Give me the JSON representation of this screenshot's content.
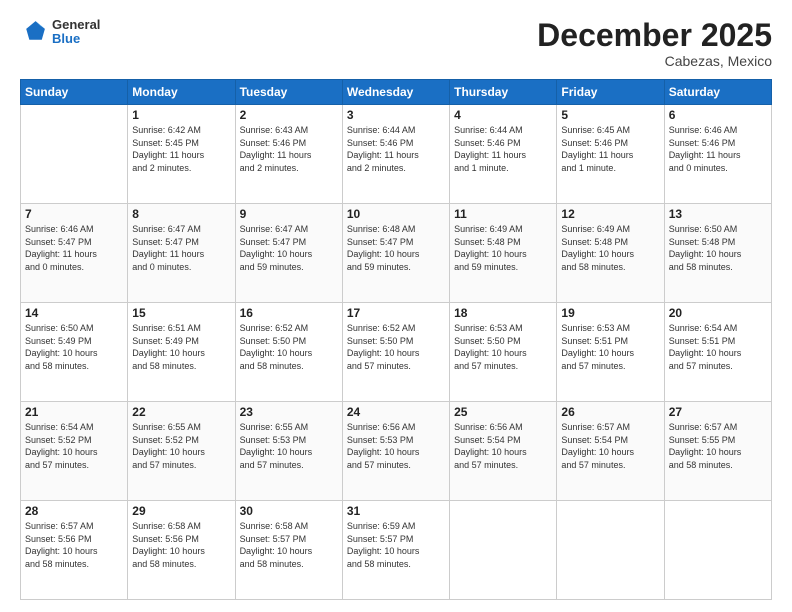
{
  "header": {
    "logo": {
      "general": "General",
      "blue": "Blue"
    },
    "title": "December 2025",
    "subtitle": "Cabezas, Mexico"
  },
  "columns": [
    "Sunday",
    "Monday",
    "Tuesday",
    "Wednesday",
    "Thursday",
    "Friday",
    "Saturday"
  ],
  "weeks": [
    [
      {
        "day": "",
        "info": ""
      },
      {
        "day": "1",
        "info": "Sunrise: 6:42 AM\nSunset: 5:45 PM\nDaylight: 11 hours\nand 2 minutes."
      },
      {
        "day": "2",
        "info": "Sunrise: 6:43 AM\nSunset: 5:46 PM\nDaylight: 11 hours\nand 2 minutes."
      },
      {
        "day": "3",
        "info": "Sunrise: 6:44 AM\nSunset: 5:46 PM\nDaylight: 11 hours\nand 2 minutes."
      },
      {
        "day": "4",
        "info": "Sunrise: 6:44 AM\nSunset: 5:46 PM\nDaylight: 11 hours\nand 1 minute."
      },
      {
        "day": "5",
        "info": "Sunrise: 6:45 AM\nSunset: 5:46 PM\nDaylight: 11 hours\nand 1 minute."
      },
      {
        "day": "6",
        "info": "Sunrise: 6:46 AM\nSunset: 5:46 PM\nDaylight: 11 hours\nand 0 minutes."
      }
    ],
    [
      {
        "day": "7",
        "info": "Sunrise: 6:46 AM\nSunset: 5:47 PM\nDaylight: 11 hours\nand 0 minutes."
      },
      {
        "day": "8",
        "info": "Sunrise: 6:47 AM\nSunset: 5:47 PM\nDaylight: 11 hours\nand 0 minutes."
      },
      {
        "day": "9",
        "info": "Sunrise: 6:47 AM\nSunset: 5:47 PM\nDaylight: 10 hours\nand 59 minutes."
      },
      {
        "day": "10",
        "info": "Sunrise: 6:48 AM\nSunset: 5:47 PM\nDaylight: 10 hours\nand 59 minutes."
      },
      {
        "day": "11",
        "info": "Sunrise: 6:49 AM\nSunset: 5:48 PM\nDaylight: 10 hours\nand 59 minutes."
      },
      {
        "day": "12",
        "info": "Sunrise: 6:49 AM\nSunset: 5:48 PM\nDaylight: 10 hours\nand 58 minutes."
      },
      {
        "day": "13",
        "info": "Sunrise: 6:50 AM\nSunset: 5:48 PM\nDaylight: 10 hours\nand 58 minutes."
      }
    ],
    [
      {
        "day": "14",
        "info": "Sunrise: 6:50 AM\nSunset: 5:49 PM\nDaylight: 10 hours\nand 58 minutes."
      },
      {
        "day": "15",
        "info": "Sunrise: 6:51 AM\nSunset: 5:49 PM\nDaylight: 10 hours\nand 58 minutes."
      },
      {
        "day": "16",
        "info": "Sunrise: 6:52 AM\nSunset: 5:50 PM\nDaylight: 10 hours\nand 58 minutes."
      },
      {
        "day": "17",
        "info": "Sunrise: 6:52 AM\nSunset: 5:50 PM\nDaylight: 10 hours\nand 57 minutes."
      },
      {
        "day": "18",
        "info": "Sunrise: 6:53 AM\nSunset: 5:50 PM\nDaylight: 10 hours\nand 57 minutes."
      },
      {
        "day": "19",
        "info": "Sunrise: 6:53 AM\nSunset: 5:51 PM\nDaylight: 10 hours\nand 57 minutes."
      },
      {
        "day": "20",
        "info": "Sunrise: 6:54 AM\nSunset: 5:51 PM\nDaylight: 10 hours\nand 57 minutes."
      }
    ],
    [
      {
        "day": "21",
        "info": "Sunrise: 6:54 AM\nSunset: 5:52 PM\nDaylight: 10 hours\nand 57 minutes."
      },
      {
        "day": "22",
        "info": "Sunrise: 6:55 AM\nSunset: 5:52 PM\nDaylight: 10 hours\nand 57 minutes."
      },
      {
        "day": "23",
        "info": "Sunrise: 6:55 AM\nSunset: 5:53 PM\nDaylight: 10 hours\nand 57 minutes."
      },
      {
        "day": "24",
        "info": "Sunrise: 6:56 AM\nSunset: 5:53 PM\nDaylight: 10 hours\nand 57 minutes."
      },
      {
        "day": "25",
        "info": "Sunrise: 6:56 AM\nSunset: 5:54 PM\nDaylight: 10 hours\nand 57 minutes."
      },
      {
        "day": "26",
        "info": "Sunrise: 6:57 AM\nSunset: 5:54 PM\nDaylight: 10 hours\nand 57 minutes."
      },
      {
        "day": "27",
        "info": "Sunrise: 6:57 AM\nSunset: 5:55 PM\nDaylight: 10 hours\nand 58 minutes."
      }
    ],
    [
      {
        "day": "28",
        "info": "Sunrise: 6:57 AM\nSunset: 5:56 PM\nDaylight: 10 hours\nand 58 minutes."
      },
      {
        "day": "29",
        "info": "Sunrise: 6:58 AM\nSunset: 5:56 PM\nDaylight: 10 hours\nand 58 minutes."
      },
      {
        "day": "30",
        "info": "Sunrise: 6:58 AM\nSunset: 5:57 PM\nDaylight: 10 hours\nand 58 minutes."
      },
      {
        "day": "31",
        "info": "Sunrise: 6:59 AM\nSunset: 5:57 PM\nDaylight: 10 hours\nand 58 minutes."
      },
      {
        "day": "",
        "info": ""
      },
      {
        "day": "",
        "info": ""
      },
      {
        "day": "",
        "info": ""
      }
    ]
  ]
}
